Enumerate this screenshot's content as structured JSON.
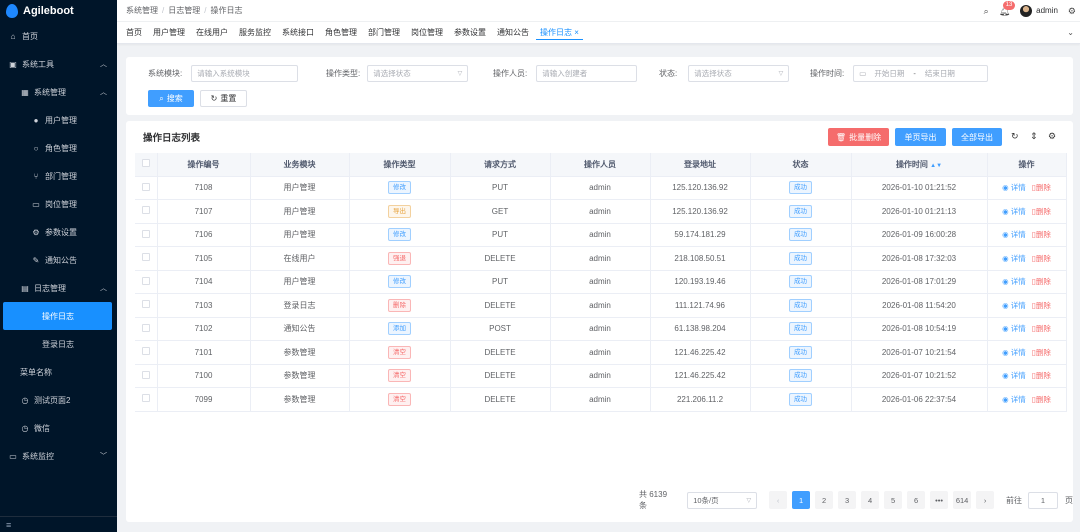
{
  "app": {
    "name": "Agileboot"
  },
  "sidebar": {
    "items": [
      {
        "label": "首页",
        "icon": "home-icon",
        "level": 0
      },
      {
        "label": "系统工具",
        "icon": "toolbox-icon",
        "level": 0,
        "expanded": true
      },
      {
        "label": "系统管理",
        "icon": "grid-icon",
        "level": 1,
        "expanded": true
      },
      {
        "label": "用户管理",
        "icon": "user-icon",
        "level": 2
      },
      {
        "label": "角色管理",
        "icon": "user-outline-icon",
        "level": 2
      },
      {
        "label": "部门管理",
        "icon": "tree-icon",
        "level": 2
      },
      {
        "label": "岗位管理",
        "icon": "postcard-icon",
        "level": 2
      },
      {
        "label": "参数设置",
        "icon": "settings-icon",
        "level": 2
      },
      {
        "label": "通知公告",
        "icon": "edit-icon",
        "level": 2
      },
      {
        "label": "日志管理",
        "icon": "document-icon",
        "level": 1,
        "expanded": true
      },
      {
        "label": "操作日志",
        "icon": "",
        "level": 3,
        "active": true
      },
      {
        "label": "登录日志",
        "icon": "",
        "level": 3
      },
      {
        "label": "菜单名称",
        "icon": "",
        "level": 1
      },
      {
        "label": "测试页面2",
        "icon": "alarm-icon",
        "level": 1
      },
      {
        "label": "微信",
        "icon": "alarm-icon",
        "level": 1
      },
      {
        "label": "系统监控",
        "icon": "monitor-icon",
        "level": 0
      }
    ],
    "collapse_icon": "≡"
  },
  "header": {
    "breadcrumb": [
      "系统管理",
      "日志管理",
      "操作日志"
    ],
    "notification_count": "13",
    "username": "admin"
  },
  "tags": [
    "首页",
    "用户管理",
    "在线用户",
    "服务监控",
    "系统接口",
    "角色管理",
    "部门管理",
    "岗位管理",
    "参数设置",
    "通知公告",
    "操作日志 ×"
  ],
  "search": {
    "module_label": "系统模块:",
    "module_placeholder": "请输入系统模块",
    "optype_label": "操作类型:",
    "optype_placeholder": "请选择状态",
    "operator_label": "操作人员:",
    "operator_placeholder": "请输入创建者",
    "status_label": "状态:",
    "status_placeholder": "请选择状态",
    "time_label": "操作时间:",
    "start_placeholder": "开始日期",
    "time_sep": "-",
    "end_placeholder": "结束日期",
    "search_btn": "搜索",
    "reset_btn": "重置"
  },
  "table": {
    "title": "操作日志列表",
    "batch_delete": "批量删除",
    "export_page": "单页导出",
    "export_all": "全部导出",
    "columns": [
      "操作编号",
      "业务模块",
      "操作类型",
      "请求方式",
      "操作人员",
      "登录地址",
      "状态",
      "操作时间",
      "操作"
    ],
    "rows": [
      {
        "id": "7108",
        "module": "用户管理",
        "type": "修改",
        "type_color": "blue",
        "method": "PUT",
        "operator": "admin",
        "ip": "125.120.136.92",
        "status": "成功",
        "time": "2026-01-10 01:21:52"
      },
      {
        "id": "7107",
        "module": "用户管理",
        "type": "导出",
        "type_color": "orange",
        "method": "GET",
        "operator": "admin",
        "ip": "125.120.136.92",
        "status": "成功",
        "time": "2026-01-10 01:21:13"
      },
      {
        "id": "7106",
        "module": "用户管理",
        "type": "修改",
        "type_color": "blue",
        "method": "PUT",
        "operator": "admin",
        "ip": "59.174.181.29",
        "status": "成功",
        "time": "2026-01-09 16:00:28"
      },
      {
        "id": "7105",
        "module": "在线用户",
        "type": "强退",
        "type_color": "red",
        "method": "DELETE",
        "operator": "admin",
        "ip": "218.108.50.51",
        "status": "成功",
        "time": "2026-01-08 17:32:03"
      },
      {
        "id": "7104",
        "module": "用户管理",
        "type": "修改",
        "type_color": "blue",
        "method": "PUT",
        "operator": "admin",
        "ip": "120.193.19.46",
        "status": "成功",
        "time": "2026-01-08 17:01:29"
      },
      {
        "id": "7103",
        "module": "登录日志",
        "type": "删除",
        "type_color": "red",
        "method": "DELETE",
        "operator": "admin",
        "ip": "111.121.74.96",
        "status": "成功",
        "time": "2026-01-08 11:54:20"
      },
      {
        "id": "7102",
        "module": "通知公告",
        "type": "添加",
        "type_color": "blue",
        "method": "POST",
        "operator": "admin",
        "ip": "61.138.98.204",
        "status": "成功",
        "time": "2026-01-08 10:54:19"
      },
      {
        "id": "7101",
        "module": "参数管理",
        "type": "清空",
        "type_color": "red",
        "method": "DELETE",
        "operator": "admin",
        "ip": "121.46.225.42",
        "status": "成功",
        "time": "2026-01-07 10:21:54"
      },
      {
        "id": "7100",
        "module": "参数管理",
        "type": "清空",
        "type_color": "red",
        "method": "DELETE",
        "operator": "admin",
        "ip": "121.46.225.42",
        "status": "成功",
        "time": "2026-01-07 10:21:52"
      },
      {
        "id": "7099",
        "module": "参数管理",
        "type": "清空",
        "type_color": "red",
        "method": "DELETE",
        "operator": "admin",
        "ip": "221.206.11.2",
        "status": "成功",
        "time": "2026-01-06 22:37:54"
      }
    ],
    "detail_label": "详情",
    "delete_label": "删除"
  },
  "pagination": {
    "total": "共 6139 条",
    "page_size": "10条/页",
    "pages": [
      "1",
      "2",
      "3",
      "4",
      "5",
      "6",
      "•••",
      "614"
    ],
    "current": "1",
    "goto_label": "前往",
    "goto_value": "1",
    "page_suffix": "页"
  },
  "colors": {
    "sidebar_bg": "#001529",
    "primary": "#409eff",
    "danger": "#f56c6c"
  }
}
